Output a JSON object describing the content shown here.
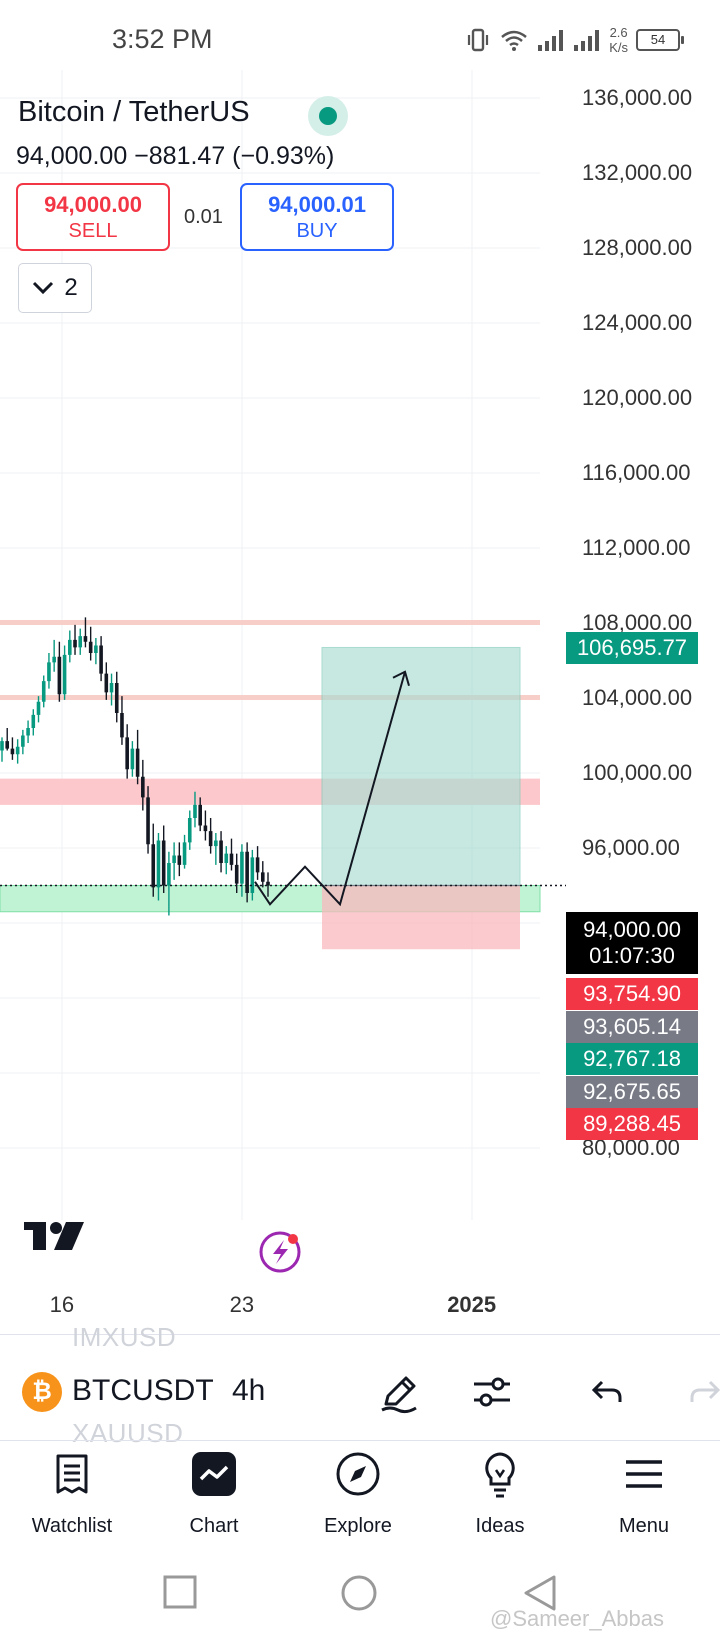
{
  "status_bar": {
    "time": "3:52 PM",
    "net_speed_value": "2.6",
    "net_speed_unit": "K/s",
    "battery": "54",
    "icons": [
      "vibrate-icon",
      "wifi-icon",
      "signal-icon",
      "signal-icon",
      "battery-icon"
    ]
  },
  "header": {
    "symbol_title": "Bitcoin / TetherUS",
    "price_line": "94,000.00  −881.47 (−0.93%)",
    "market_status": "open",
    "sell": {
      "price": "94,000.00",
      "label": "SELL"
    },
    "spread": "0.01",
    "buy": {
      "price": "94,000.01",
      "label": "BUY"
    },
    "indicators_count": "2"
  },
  "chart_data": {
    "type": "candlestick",
    "symbol": "BTCUSDT",
    "interval": "4h",
    "y_ticks": [
      "136,000.00",
      "132,000.00",
      "128,000.00",
      "124,000.00",
      "120,000.00",
      "116,000.00",
      "112,000.00",
      "108,000.00",
      "104,000.00",
      "100,000.00",
      "96,000.00",
      "80,000.00"
    ],
    "x_ticks": [
      "16",
      "23",
      "2025"
    ],
    "ylim": [
      78000,
      137000
    ],
    "last_price": "94,000.00",
    "countdown": "01:07:30",
    "price_labels": [
      {
        "value": "106,695.77",
        "color": "#089981"
      },
      {
        "value": "93,754.90",
        "color": "#f23645"
      },
      {
        "value": "93,605.14",
        "color": "#787b86"
      },
      {
        "value": "92,767.18",
        "color": "#089981"
      },
      {
        "value": "92,675.65",
        "color": "#787b86"
      },
      {
        "value": "89,288.45",
        "color": "#f23645"
      }
    ],
    "horizontal_levels": [
      108000,
      104000
    ],
    "zones": [
      {
        "from": 98300,
        "to": 99700,
        "color": "red"
      },
      {
        "from": 92600,
        "to": 94000,
        "color": "green"
      }
    ],
    "long_position": {
      "entry": 94000,
      "target": 106695.77,
      "stop": 90600
    },
    "candles": [
      [
        101200,
        101900,
        100600,
        101700
      ],
      [
        101700,
        102400,
        101200,
        101300
      ],
      [
        101300,
        101900,
        100700,
        101000
      ],
      [
        101000,
        101800,
        100500,
        101400
      ],
      [
        101400,
        102300,
        101000,
        102000
      ],
      [
        102000,
        102800,
        101600,
        102400
      ],
      [
        102400,
        103400,
        102000,
        103100
      ],
      [
        103100,
        104100,
        102700,
        103800
      ],
      [
        103800,
        105200,
        103500,
        104900
      ],
      [
        104900,
        106400,
        104500,
        105900
      ],
      [
        105900,
        107100,
        105400,
        106200
      ],
      [
        106200,
        107000,
        103800,
        104200
      ],
      [
        104200,
        106800,
        103900,
        106300
      ],
      [
        106300,
        107600,
        105900,
        107100
      ],
      [
        107100,
        107900,
        106300,
        106700
      ],
      [
        106700,
        107700,
        106300,
        107300
      ],
      [
        107300,
        108300,
        106700,
        107000
      ],
      [
        107000,
        107800,
        106000,
        106400
      ],
      [
        106400,
        107200,
        105800,
        106800
      ],
      [
        106800,
        107300,
        104900,
        105300
      ],
      [
        105300,
        105900,
        103900,
        104300
      ],
      [
        104300,
        105300,
        103600,
        104800
      ],
      [
        104800,
        105400,
        102700,
        103200
      ],
      [
        103200,
        104100,
        101500,
        101900
      ],
      [
        101900,
        102600,
        99700,
        100200
      ],
      [
        100200,
        101700,
        99800,
        101300
      ],
      [
        101300,
        102300,
        99400,
        99800
      ],
      [
        99800,
        100700,
        98000,
        98700
      ],
      [
        98700,
        99300,
        95700,
        96200
      ],
      [
        96200,
        97300,
        93400,
        93900
      ],
      [
        93900,
        96800,
        93200,
        96400
      ],
      [
        96400,
        97200,
        93600,
        94000
      ],
      [
        94000,
        95800,
        92400,
        95200
      ],
      [
        95200,
        96300,
        94300,
        95600
      ],
      [
        95600,
        96300,
        94500,
        95100
      ],
      [
        95100,
        96700,
        94900,
        96300
      ],
      [
        96300,
        98000,
        95900,
        97600
      ],
      [
        97600,
        99000,
        97100,
        98300
      ],
      [
        98300,
        98700,
        96900,
        97200
      ],
      [
        97200,
        98000,
        96400,
        96900
      ],
      [
        96900,
        97600,
        95700,
        96100
      ],
      [
        96100,
        96800,
        95100,
        96400
      ],
      [
        96400,
        96900,
        94700,
        95200
      ],
      [
        95200,
        96100,
        94600,
        95700
      ],
      [
        95700,
        96500,
        94800,
        95100
      ],
      [
        95100,
        95700,
        93600,
        94100
      ],
      [
        94100,
        96200,
        93400,
        95800
      ],
      [
        95800,
        96300,
        93100,
        93600
      ],
      [
        93600,
        95900,
        93200,
        95500
      ],
      [
        95500,
        96100,
        94300,
        94700
      ],
      [
        94700,
        95300,
        93900,
        94200
      ],
      [
        94200,
        94700,
        93400,
        94000
      ]
    ],
    "projection_path": [
      [
        255,
        94200
      ],
      [
        270,
        93000
      ],
      [
        305,
        95000
      ],
      [
        340,
        93000
      ],
      [
        405,
        105400
      ]
    ]
  },
  "toolbar": {
    "ghost_above": "IMXUSD",
    "ghost_below": "XAUUSD",
    "symbol": "BTCUSDT",
    "coin_glyph": "₿",
    "interval": "4h"
  },
  "bottom_nav": {
    "items": [
      {
        "label": "Watchlist",
        "icon": "watchlist-icon"
      },
      {
        "label": "Chart",
        "icon": "chart-icon"
      },
      {
        "label": "Explore",
        "icon": "compass-icon"
      },
      {
        "label": "Ideas",
        "icon": "lightbulb-icon"
      },
      {
        "label": "Menu",
        "icon": "menu-icon"
      }
    ]
  },
  "watermark": "@Sameer_Abbas"
}
